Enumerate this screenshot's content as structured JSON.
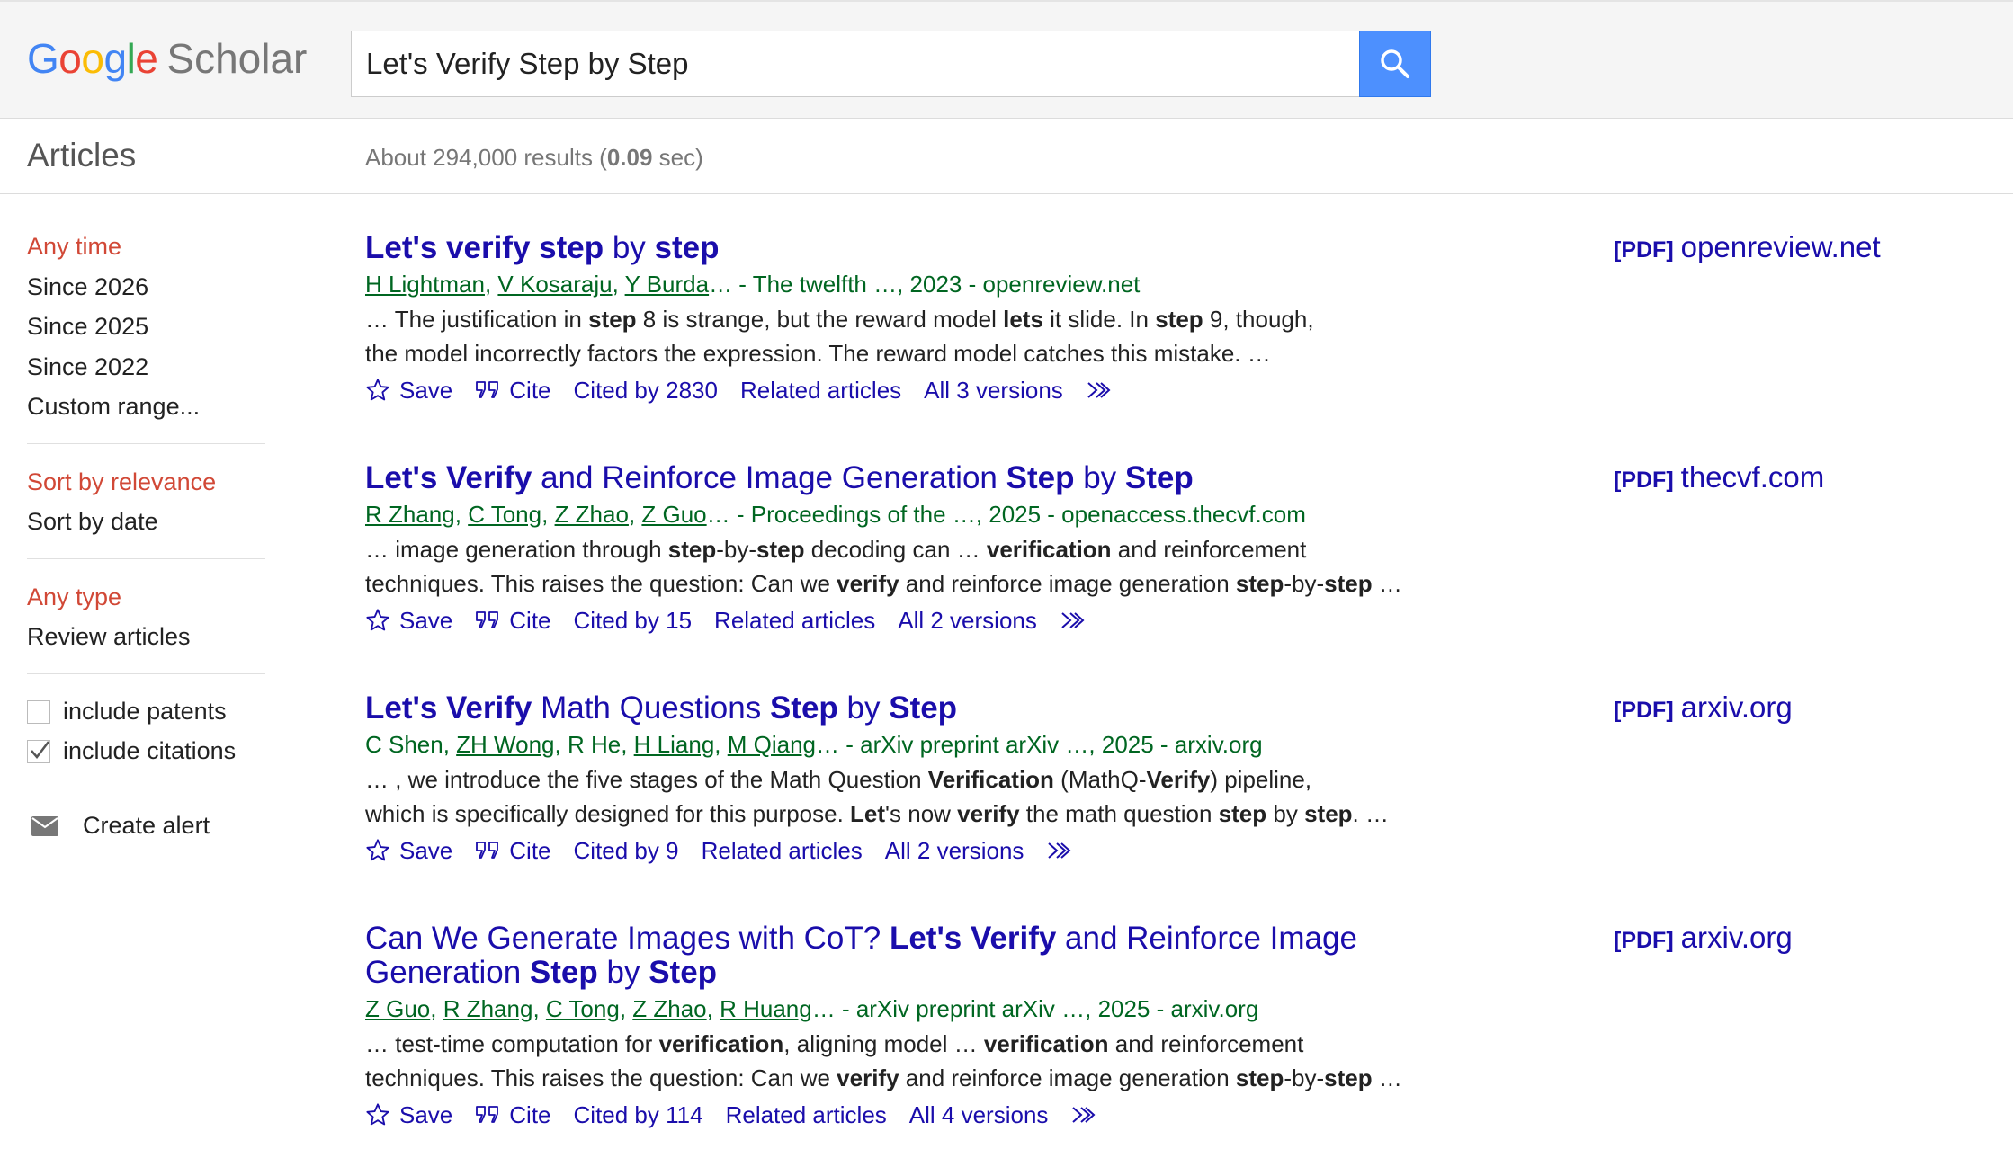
{
  "header": {
    "logo_letters": [
      "G",
      "o",
      "o",
      "g",
      "l",
      "e"
    ],
    "logo_colors": [
      "#4285f4",
      "#ea4335",
      "#fbbc05",
      "#4285f4",
      "#34a853",
      "#ea4335"
    ],
    "logo_product": "Scholar",
    "search_value": "Let's Verify Step by Step",
    "search_button_icon": "search-icon"
  },
  "subheader": {
    "section": "Articles",
    "results_prefix": "About 294,000 results (",
    "results_time": "0.09",
    "results_suffix": " sec)"
  },
  "sidebar": {
    "time_filters": [
      "Any time",
      "Since 2026",
      "Since 2025",
      "Since 2022",
      "Custom range..."
    ],
    "sort_options": [
      "Sort by relevance",
      "Sort by date"
    ],
    "type_filters": [
      "Any type",
      "Review articles"
    ],
    "include_patents": "include patents",
    "include_citations": "include citations",
    "include_patents_checked": false,
    "include_citations_checked": true,
    "create_alert": "Create alert"
  },
  "common": {
    "save": "Save",
    "cite": "Cite",
    "related": "Related articles",
    "pdf_tag": "[PDF]"
  },
  "results": [
    {
      "title_html": "<b>Let's verify step</b> by <b>step</b>",
      "authors_html": "<a>H Lightman</a>, <a>V Kosaraju</a>, <a>Y Burda</a>… - The twelfth …, 2023 - openreview.net",
      "snippet_html": "… The justification in <b>step</b> 8 is strange, but the reward model <b>lets</b> it slide. In <b>step</b> 9, though,<br>the model incorrectly factors the expression. The reward model catches this mistake. …",
      "cited_by": "Cited by 2830",
      "versions": "All 3 versions",
      "pdf_domain": "openreview.net"
    },
    {
      "title_html": "<b>Let's Verify</b> and Reinforce Image Generation <b>Step</b> by <b>Step</b>",
      "authors_html": "<a>R Zhang</a>, <a>C Tong</a>, <a>Z Zhao</a>, <a>Z Guo</a>… - Proceedings of the …, 2025 - openaccess.thecvf.com",
      "snippet_html": "… image generation through <b>step</b>-by-<b>step</b> decoding can … <b>verification</b> and reinforcement<br>techniques. This raises the question: Can we <b>verify</b> and reinforce image generation <b>step</b>-by-<b>step</b> …",
      "cited_by": "Cited by 15",
      "versions": "All 2 versions",
      "pdf_domain": "thecvf.com"
    },
    {
      "title_html": "<b>Let's Verify</b> Math Questions <b>Step</b> by <b>Step</b>",
      "authors_html": "C Shen, <a>ZH Wong</a>, R He, <a>H Liang</a>, <a>M Qiang</a>… - arXiv preprint arXiv …, 2025 - arxiv.org",
      "snippet_html": "… , we introduce the five stages of the Math Question <b>Verification</b> (MathQ-<b>Verify</b>) pipeline,<br>which is specifically designed for this purpose. <b>Let</b>'s now <b>verify</b> the math question <b>step</b> by <b>step</b>. …",
      "cited_by": "Cited by 9",
      "versions": "All 2 versions",
      "pdf_domain": "arxiv.org"
    },
    {
      "title_html": "Can We Generate Images with CoT? <b>Let's Verify</b> and Reinforce Image<br>Generation <b>Step</b> by <b>Step</b>",
      "authors_html": "<a>Z Guo</a>, <a>R Zhang</a>, <a>C Tong</a>, <a>Z Zhao</a>, <a>R Huang</a>… - arXiv preprint arXiv …, 2025 - arxiv.org",
      "snippet_html": "… test-time computation for <b>verification</b>, aligning model … <b>verification</b> and reinforcement<br>techniques. This raises the question: Can we <b>verify</b> and reinforce image generation <b>step</b>-by-<b>step</b> …",
      "cited_by": "Cited by 114",
      "versions": "All 4 versions",
      "pdf_domain": "arxiv.org"
    }
  ]
}
